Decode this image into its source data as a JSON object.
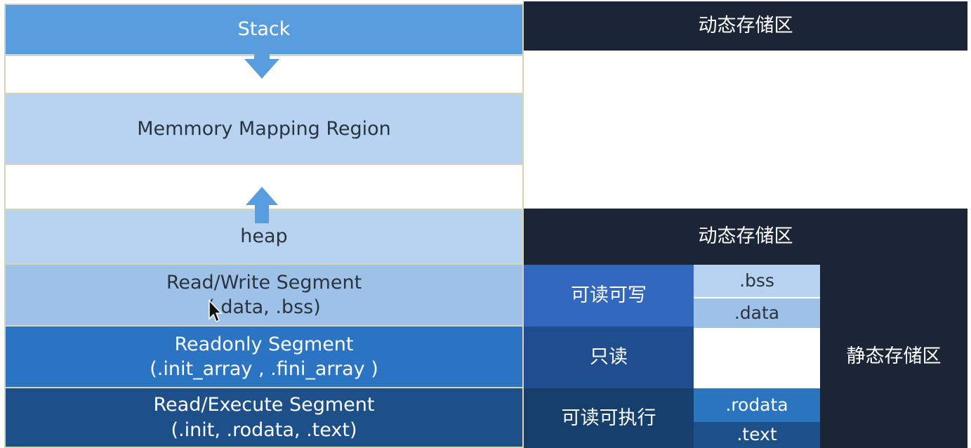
{
  "colors": {
    "stack": "#5a9ddf",
    "light_blue": "#b7d3ef",
    "mid_blue": "#9dc1e7",
    "readonly": "#2b73c3",
    "rx": "#1d4f88",
    "navy": "#1b2535",
    "rw_cn": "#3268bd",
    "ro_cn": "#1f4d8e",
    "rx_cn": "#173f6e",
    "rodata": "#2a74c0",
    "text": "#1d4f88",
    "arrow": "#5a9ddf"
  },
  "left": {
    "stack": "Stack",
    "mmap": "Memmory Mapping Region",
    "heap": "heap",
    "rw": {
      "title": "Read/Write Segment",
      "sub": "(.data, .bss)"
    },
    "ro": {
      "title": "Readonly Segment",
      "sub": "(.init_array ,   .fini_array )"
    },
    "rx": {
      "title": "Read/Execute Segment",
      "sub": "(.init, .rodata, .text)"
    }
  },
  "right": {
    "dynamic_top": "动态存储区",
    "dynamic_mid": "动态存储区",
    "rw": "可读可写",
    "ro": "只读",
    "rx": "可读可执行",
    "bss": ".bss",
    "data": ".data",
    "rodata": ".rodata",
    "text": ".text",
    "static": "静态存储区"
  }
}
